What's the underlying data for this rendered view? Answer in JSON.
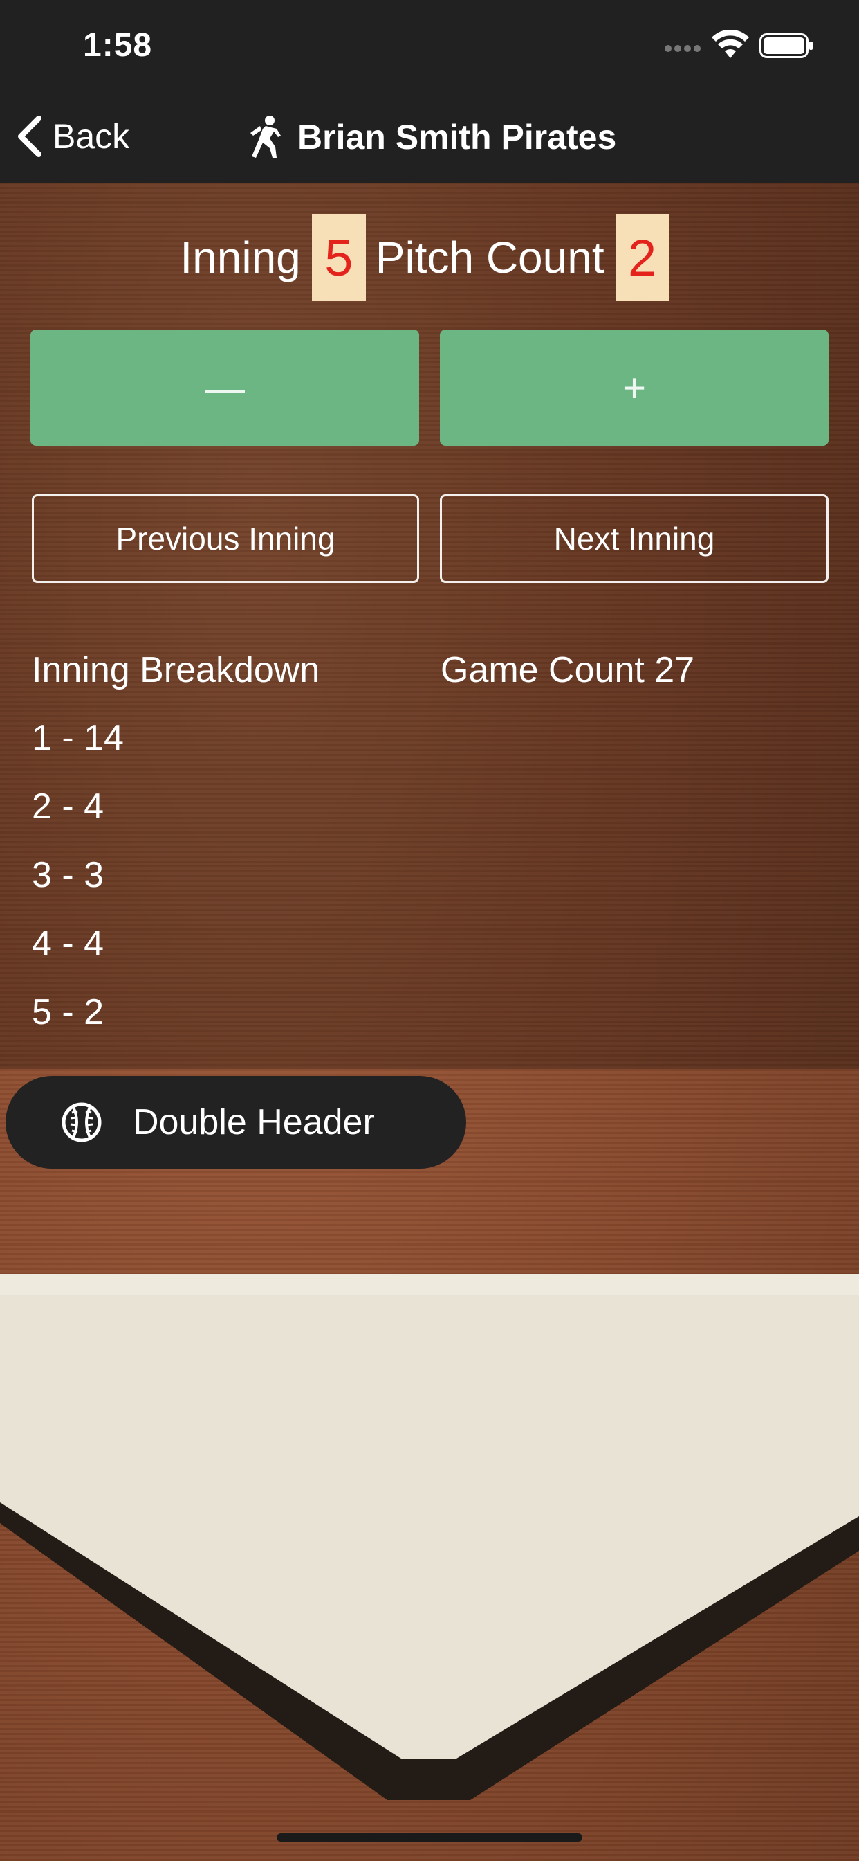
{
  "status_bar": {
    "time": "1:58"
  },
  "nav": {
    "back_label": "Back",
    "title": "Brian Smith Pirates"
  },
  "counters": {
    "inning_label": "Inning",
    "inning_value": "5",
    "pitch_label": "Pitch Count",
    "pitch_value": "2"
  },
  "controls": {
    "minus_glyph": "—",
    "plus_glyph": "+",
    "previous_inning": "Previous Inning",
    "next_inning": "Next Inning"
  },
  "breakdown": {
    "title": "Inning Breakdown",
    "game_count": "Game Count 27",
    "innings": [
      "1 - 14",
      "2 - 4",
      "3 - 3",
      "4 - 4",
      "5 - 2"
    ]
  },
  "double_header": {
    "label": "Double Header"
  },
  "colors": {
    "bar_bg": "#212121",
    "step_button": "#6bb683",
    "counter_box": "#f7e0b8",
    "counter_digit": "#e3231c"
  },
  "icons": [
    "chevron-left-icon",
    "pitcher-icon",
    "baseball-icon",
    "signal-icon",
    "wifi-icon",
    "battery-icon"
  ]
}
